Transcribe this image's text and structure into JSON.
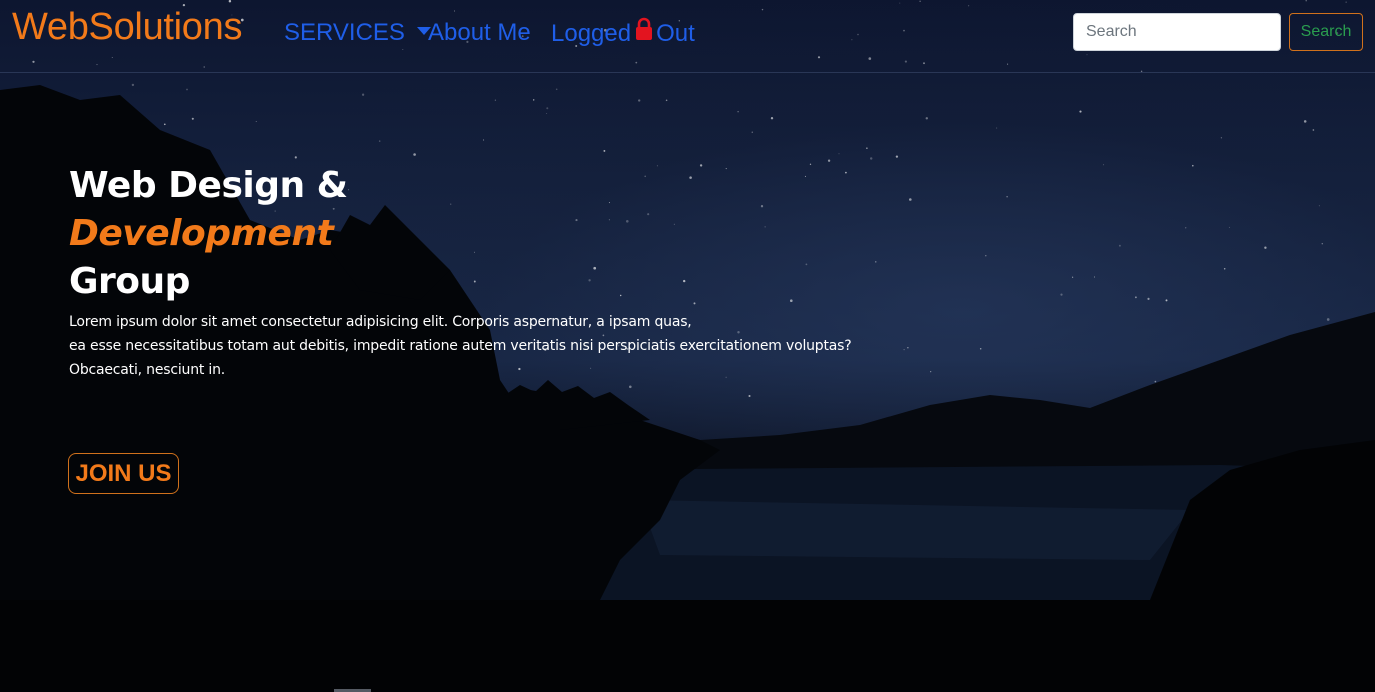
{
  "navbar": {
    "brand": "WebSolutions",
    "links": {
      "services": "SERVICES",
      "about": "About Me",
      "logged": "Logged",
      "out": "Out"
    },
    "search_placeholder": "Search",
    "search_button": "Search"
  },
  "hero": {
    "title_line1": "Web Design &",
    "title_accent": "Development",
    "title_line3": "Group",
    "text_lines": [
      "Lorem ipsum dolor sit amet consectetur adipisicing elit. Corporis aspernatur, a ipsam quas,",
      "ea esse necessitatibus totam aut debitis, impedit ratione autem veritatis nisi perspiciatis exercitationem voluptas?",
      "Obcaecati, nesciunt in."
    ],
    "join_button": "JOIN US"
  },
  "colors": {
    "brand_orange": "#f27a1a",
    "nav_blue": "#1f5ee8",
    "search_green": "#2a9d4f",
    "lock_red": "#e3141f"
  },
  "icons": {
    "services_dropdown": "caret-down-icon",
    "logout": "lock-icon"
  }
}
